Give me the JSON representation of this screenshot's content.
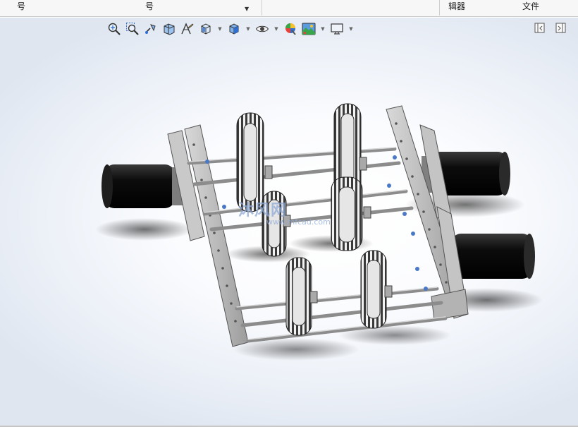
{
  "ribbon": {
    "items": [
      {
        "label": "号"
      },
      {
        "label": "号"
      },
      {
        "label": "辑器"
      },
      {
        "label": "文件"
      }
    ]
  },
  "viewport_toolbar": {
    "buttons": [
      {
        "icon": "zoom-to-fit-icon"
      },
      {
        "icon": "zoom-to-area-icon"
      },
      {
        "icon": "previous-view-icon"
      },
      {
        "icon": "section-view-icon"
      },
      {
        "icon": "dynamic-annotation-icon"
      },
      {
        "icon": "view-orientation-icon"
      },
      {
        "icon": "display-style-icon"
      },
      {
        "icon": "hide-show-items-icon"
      },
      {
        "icon": "edit-appearance-icon"
      },
      {
        "icon": "apply-scene-icon"
      },
      {
        "icon": "view-settings-icon"
      }
    ]
  },
  "watermark": {
    "text": "沐风网",
    "url": "www.mfcad.com"
  },
  "colors": {
    "viewport_bg": "#e9eef6",
    "frame_metal": "#b9b9b9",
    "motor_black": "#111111",
    "toolbar_blue": "#2f6fd1"
  }
}
